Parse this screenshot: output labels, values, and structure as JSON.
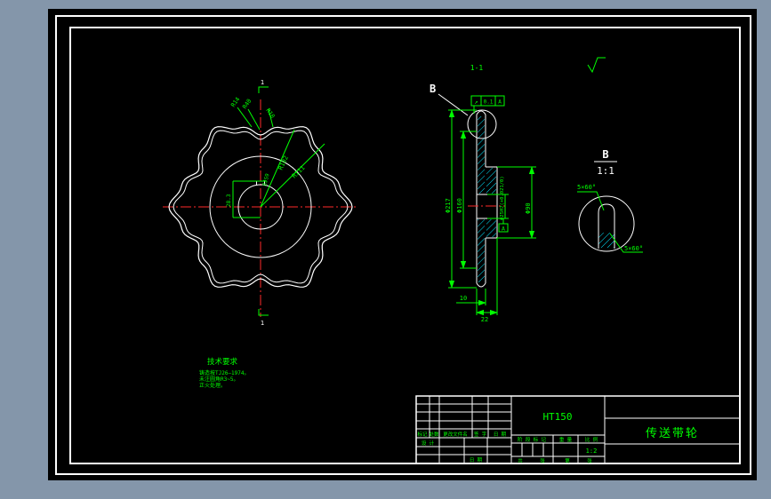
{
  "canvas": {
    "bg_color": "#8496aa",
    "sheet_color": "#000000",
    "line_color": "#ffffff",
    "dim_color": "#00ff00",
    "centerline_color": "#ff2a2a",
    "hatch_color": "#00e5ff"
  },
  "front_view": {
    "labels": {
      "r14": "R14",
      "r40": "R40",
      "r10": "R10",
      "r102": "R102",
      "r111": "R111",
      "keyway_width": "8JS9",
      "keyway_depth": "28.3"
    },
    "section_marks": {
      "top": "1",
      "bottom": "1"
    }
  },
  "section_view": {
    "view_label": "1-1",
    "detail_callout": "B",
    "dims": {
      "outer": "Φ217",
      "rim": "Φ160",
      "hub": "Φ90",
      "bore": "Φ25H7(+0.021/0)",
      "web_thickness": "10",
      "hub_length": "22"
    },
    "fcf": {
      "symbol": "↗",
      "tolerance": "0.1",
      "datum": "A"
    },
    "datum": "A"
  },
  "detail_view": {
    "name": "B",
    "scale": "1:1",
    "chamfer_top": "5×60°",
    "chamfer_bottom": "5×60°"
  },
  "tech_notes": {
    "title": "技术要求",
    "line1": "铸造按TJ26—1974。",
    "line2": "未注圆角R3~5。",
    "line3": "正火处理。"
  },
  "title_block": {
    "material": "HT150",
    "part_name": "传送带轮",
    "scale_value": "1:2",
    "rev_row": {
      "c1": "标记",
      "c2": "处数",
      "c3": "更改文件名",
      "c4": "签 字",
      "c5": "日 期"
    },
    "design_label": "设 计",
    "date_label": "日 期",
    "stage_label": "阶 段 标 记",
    "weight_label": "重 量",
    "scale_label": "比 例",
    "total_label": "共",
    "sheet_label": "张",
    "no_label": "第",
    "sheet_label2": "张"
  }
}
